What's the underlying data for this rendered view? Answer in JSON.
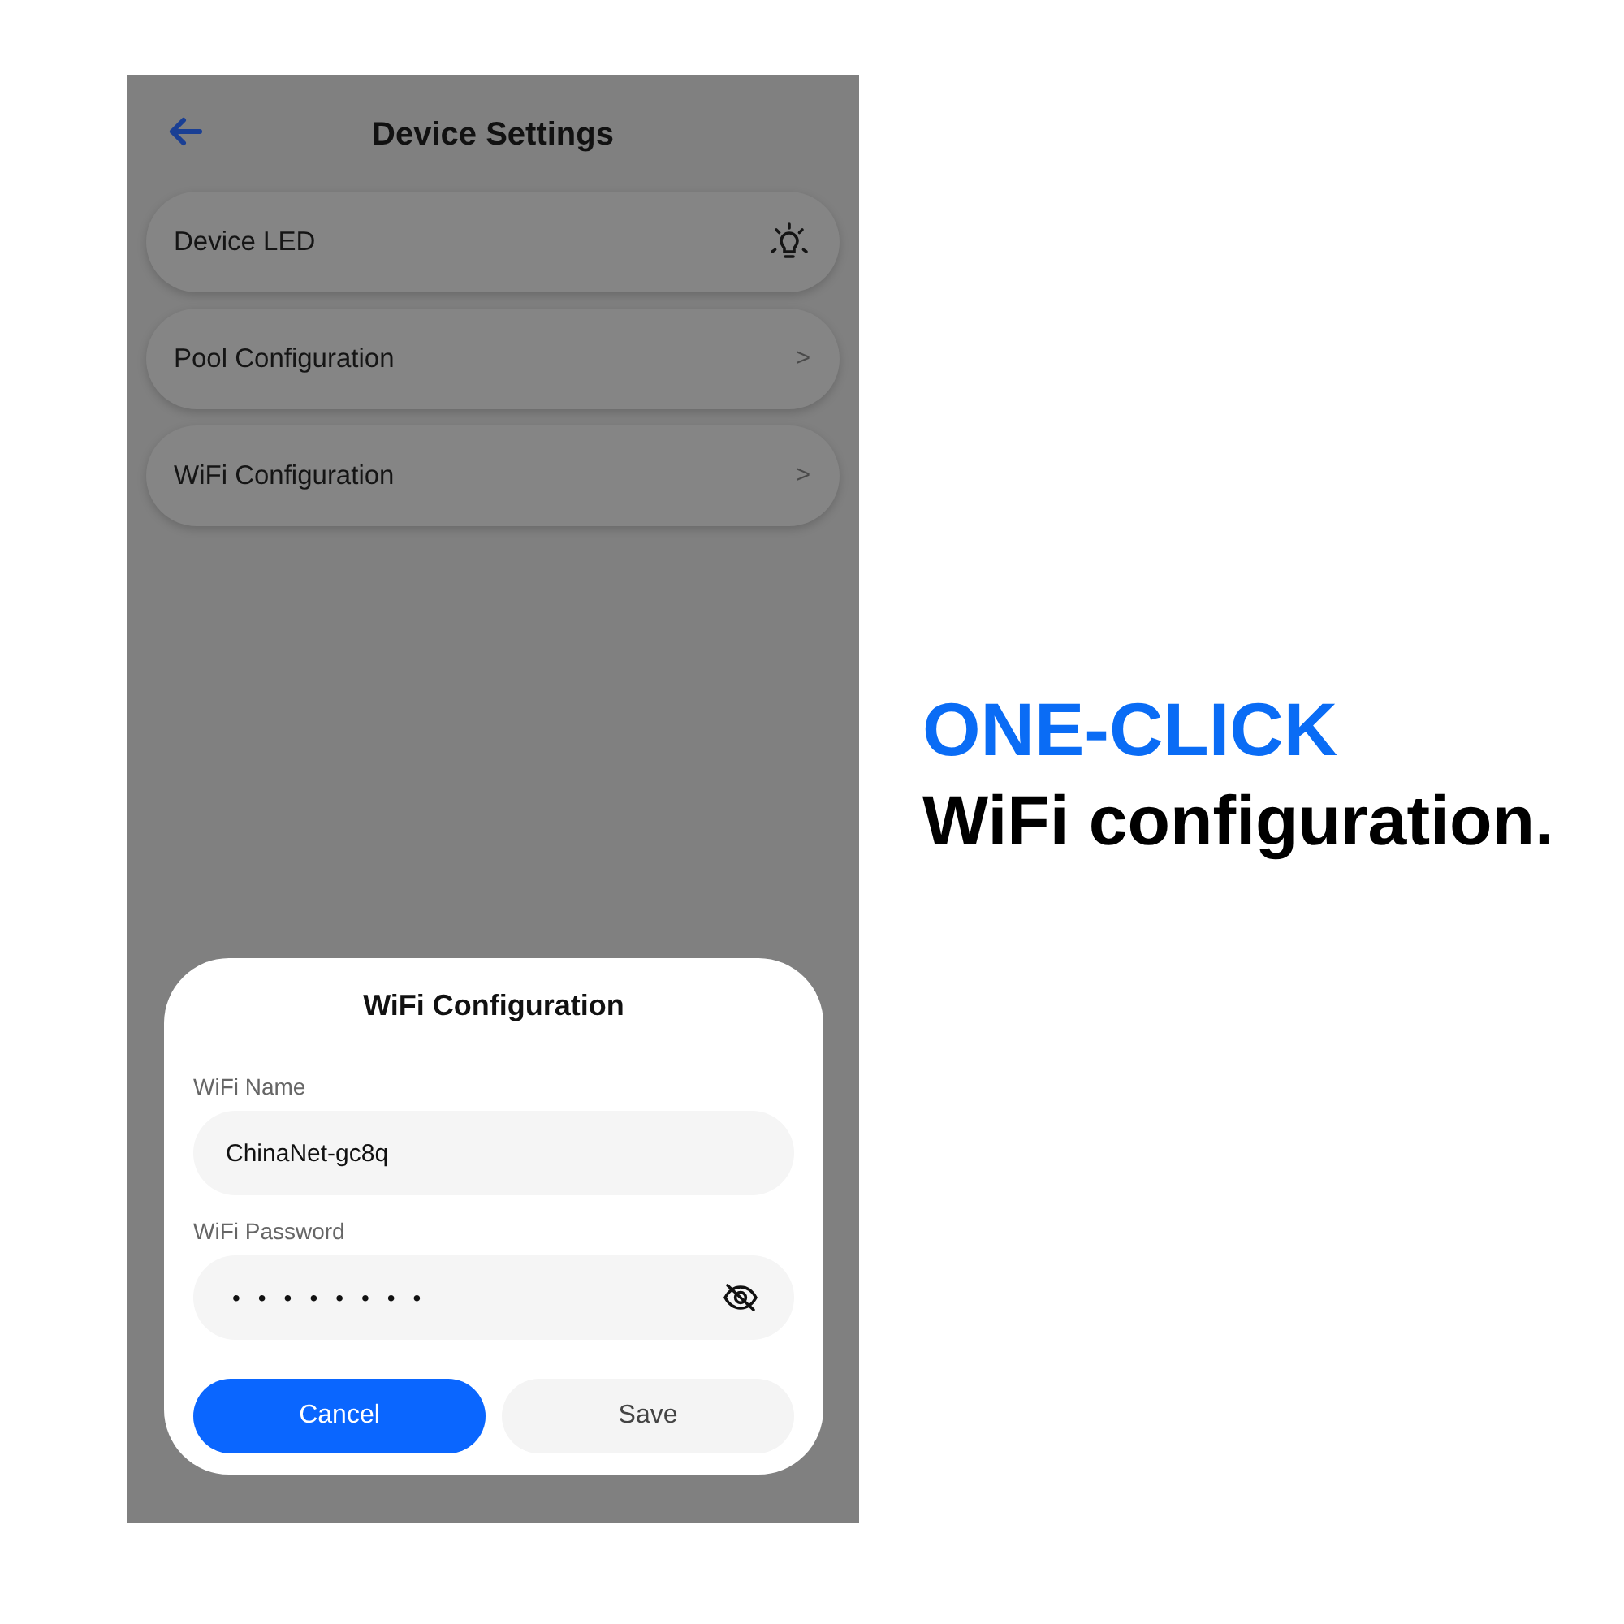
{
  "screen": {
    "header": {
      "title": "Device Settings"
    },
    "settings": [
      {
        "label": "Device LED",
        "kind": "icon"
      },
      {
        "label": "Pool Configuration",
        "kind": "chevron",
        "trailing": ">"
      },
      {
        "label": "WiFi Configuration",
        "kind": "chevron",
        "trailing": ">"
      }
    ]
  },
  "dialog": {
    "title": "WiFi Configuration",
    "fields": [
      {
        "label": "WiFi Name",
        "value": "ChinaNet-gc8q",
        "kind": "text"
      },
      {
        "label": "WiFi Password",
        "value": "••••••••",
        "kind": "password"
      }
    ],
    "buttons": [
      {
        "label": "Cancel",
        "kind": "primary"
      },
      {
        "label": "Save",
        "kind": "secondary"
      }
    ]
  },
  "caption": {
    "headline": "ONE-CLICK",
    "subline": "WiFi configuration."
  }
}
